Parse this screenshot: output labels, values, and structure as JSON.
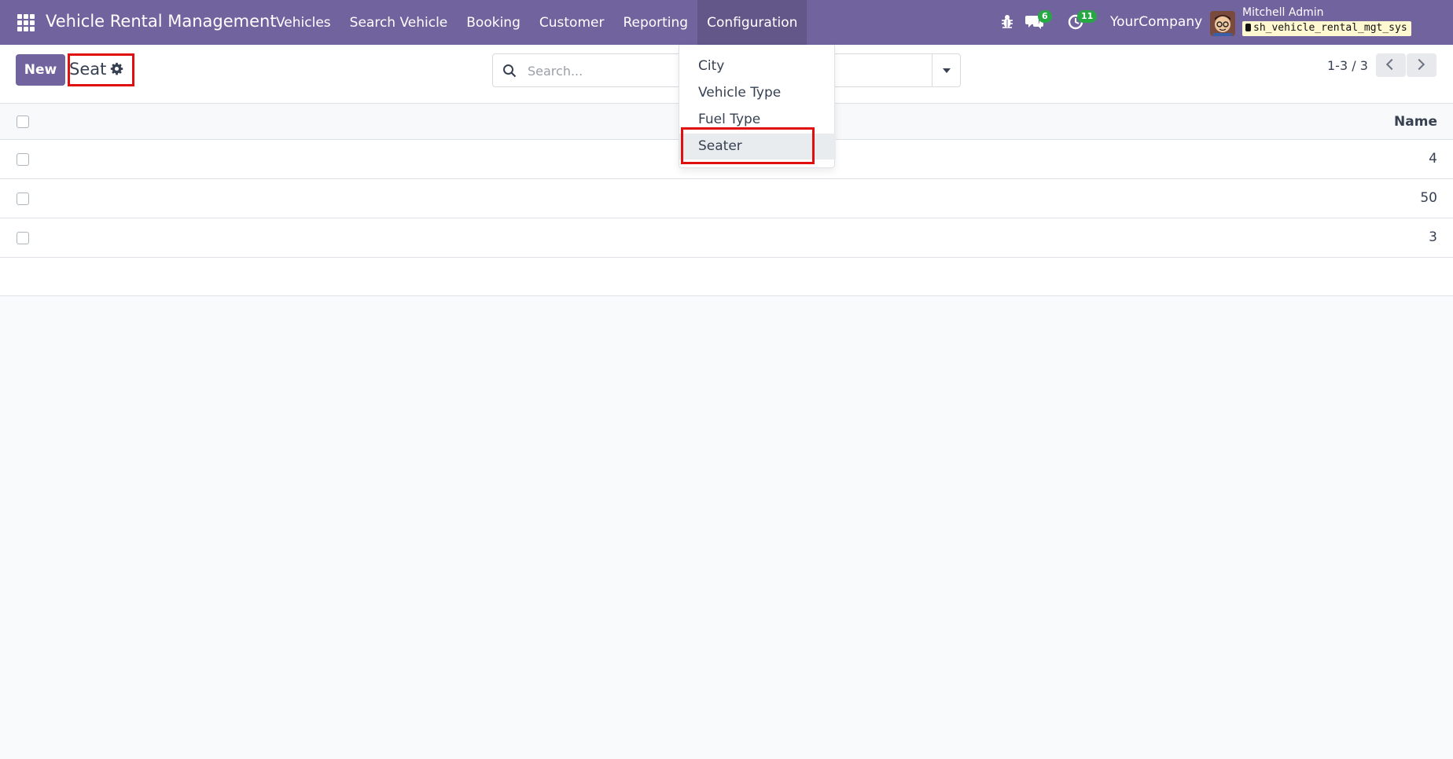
{
  "navbar": {
    "brand": "Vehicle Rental Management",
    "menu": [
      "Vehicles",
      "Search Vehicle",
      "Booking",
      "Customer",
      "Reporting",
      "Configuration"
    ],
    "active_menu": "Configuration",
    "chat_count": "6",
    "activity_count": "11",
    "company": "YourCompany",
    "user_name": "Mitchell Admin",
    "database": "sh_vehicle_rental_mgt_sys"
  },
  "control_panel": {
    "new_label": "New",
    "title": "Seat",
    "search_placeholder": "Search...",
    "pager": "1-3 / 3"
  },
  "list": {
    "column_header": "Name",
    "rows": [
      "4",
      "50",
      "3"
    ]
  },
  "dropdown": {
    "items": [
      "City",
      "Vehicle Type",
      "Fuel Type",
      "Seater"
    ],
    "hovered": "Seater"
  },
  "colors": {
    "navbar": "#71639e",
    "badge": "#28a745",
    "highlight": "#e01010"
  }
}
